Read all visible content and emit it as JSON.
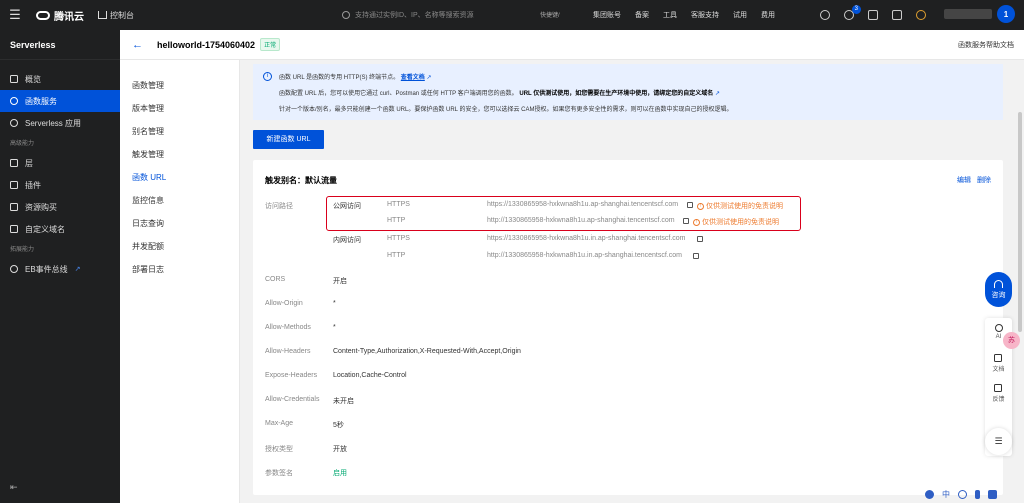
{
  "topbar": {
    "logo": "腾讯云",
    "console": "控制台",
    "search_placeholder": "支持通过实例ID、IP、名称等搜索资源",
    "shortcut": "快捷键/",
    "nav": [
      "集团账号",
      "备案",
      "工具",
      "客服支持",
      "试用",
      "费用"
    ],
    "notify_count": "3",
    "avatar": "1"
  },
  "sidebar": {
    "brand": "Serverless",
    "items": [
      {
        "label": "概览",
        "icon": "grid-icon"
      },
      {
        "label": "函数服务",
        "icon": "function-icon"
      },
      {
        "label": "Serverless 应用",
        "icon": "gear-icon"
      }
    ],
    "group1": "高级能力",
    "items2": [
      {
        "label": "层",
        "icon": "layers-icon"
      },
      {
        "label": "插件",
        "icon": "plugin-icon"
      },
      {
        "label": "资源购买",
        "icon": "cart-icon"
      },
      {
        "label": "自定义域名",
        "icon": "domain-icon"
      }
    ],
    "group2": "拓展能力",
    "items3": [
      {
        "label": "EB事件总线",
        "icon": "bus-icon"
      }
    ]
  },
  "header": {
    "title": "helloworld-1754060402",
    "status": "正常",
    "help": "函数服务帮助文档"
  },
  "submenu": [
    "函数管理",
    "版本管理",
    "别名管理",
    "触发管理",
    "函数 URL",
    "监控信息",
    "日志查询",
    "并发配额",
    "部署日志"
  ],
  "notice": {
    "line1_a": "函数 URL 是函数的专用 HTTP(S) 终端节点。",
    "line1_link": "查看文档",
    "line2_a": "函数配置 URL 后，您可以使用它通过 curl、Postman 或任何 HTTP 客户端调用您的函数。",
    "line2_b": "URL 仅供测试使用，如您需要在生产环境中使用，请绑定您的自定义域名",
    "line3": "针对一个版本/别名，最多只能创建一个函数 URL。要保护函数 URL 的安全，您可以选择云 CAM授权。如果您有更多安全性的需求，则可以在函数中实现自己的授权逻辑。"
  },
  "new_button": "新建函数 URL",
  "card": {
    "title": "触发别名：默认流量",
    "edit": "编辑",
    "delete": "删除",
    "path_label": "访问路径",
    "public": "公网访问",
    "private": "内网访问",
    "urls": [
      {
        "group": "公网访问",
        "proto": "HTTPS",
        "url": "https://1330865958-hxkwna8h1u.ap-shanghai.tencentscf.com",
        "warn": "仅供测试使用的免责说明"
      },
      {
        "group": "",
        "proto": "HTTP",
        "url": "http://1330865958-hxkwna8h1u.ap-shanghai.tencentscf.com",
        "warn": "仅供测试使用的免责说明"
      },
      {
        "group": "内网访问",
        "proto": "HTTPS",
        "url": "https://1330865958-hxkwna8h1u.in.ap-shanghai.tencentscf.com",
        "warn": ""
      },
      {
        "group": "",
        "proto": "HTTP",
        "url": "http://1330865958-hxkwna8h1u.in.ap-shanghai.tencentscf.com",
        "warn": ""
      }
    ],
    "fields": [
      {
        "k": "CORS",
        "v": "开启"
      },
      {
        "k": "Allow-Origin",
        "v": "*"
      },
      {
        "k": "Allow-Methods",
        "v": "*"
      },
      {
        "k": "Allow-Headers",
        "v": "Content-Type,Authorization,X-Requested-With,Accept,Origin"
      },
      {
        "k": "Expose-Headers",
        "v": "Location,Cache-Control"
      },
      {
        "k": "Allow-Credentials",
        "v": "未开启"
      },
      {
        "k": "Max-Age",
        "v": "5秒"
      },
      {
        "k": "授权类型",
        "v": "开放"
      },
      {
        "k": "参数签名",
        "v": "启用"
      }
    ]
  },
  "float": {
    "ask": "咨询",
    "ai": "AI",
    "docs": "文档",
    "feedback": "反馈",
    "pink": "苏",
    "bottom_zh": "中"
  }
}
